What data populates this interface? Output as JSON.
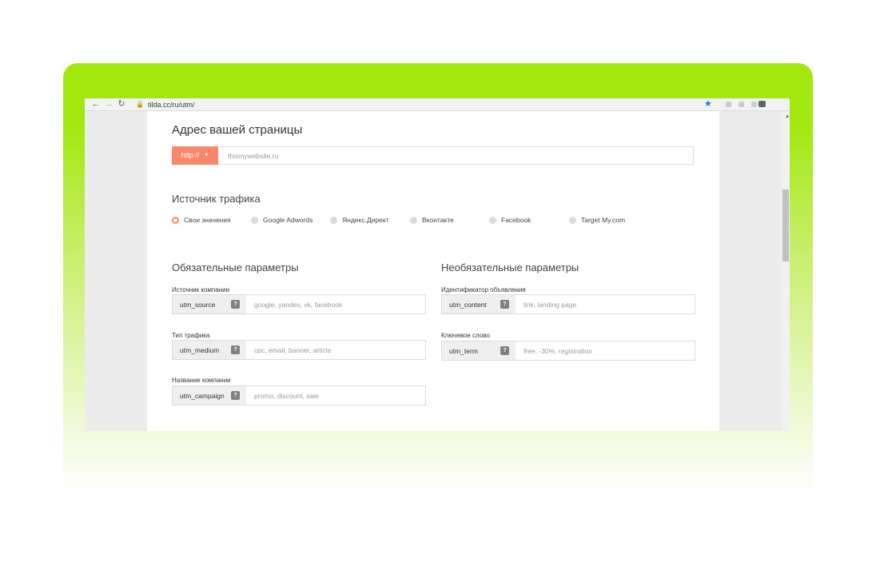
{
  "browser": {
    "url": "tilda.cc/ru/utm/",
    "icons": {
      "back": "arrow-left-icon",
      "forward": "arrow-right-icon",
      "reload": "reload-icon",
      "lock": "lock-icon",
      "bookmark": "star-icon"
    }
  },
  "address_section": {
    "title": "Адрес вашей страницы",
    "protocol": "http://",
    "placeholder": "thismywebsite.ru"
  },
  "traffic": {
    "title": "Источник трафика",
    "options": [
      {
        "label": "Свои значения",
        "selected": true
      },
      {
        "label": "Google Adwords",
        "selected": false
      },
      {
        "label": "Яндекс.Директ",
        "selected": false
      },
      {
        "label": "Вконтакте",
        "selected": false
      },
      {
        "label": "Facebook",
        "selected": false
      },
      {
        "label": "Target My.com",
        "selected": false
      }
    ]
  },
  "required": {
    "title": "Обязательные параметры",
    "fields": [
      {
        "label": "Источник компании",
        "tag": "utm_source",
        "placeholder": "google, yandex, vk, facebook"
      },
      {
        "label": "Тип трафика",
        "tag": "utm_medium",
        "placeholder": "cpc, email, banner, article"
      },
      {
        "label": "Название компании",
        "tag": "utm_campaign",
        "placeholder": "promo, discount, sale"
      }
    ]
  },
  "optional": {
    "title": "Необязательные параметры",
    "fields": [
      {
        "label": "Идентификатор объявления",
        "tag": "utm_content",
        "placeholder": "link, landing page"
      },
      {
        "label": "Ключевое слово",
        "tag": "utm_term",
        "placeholder": "free, -30%, registration"
      }
    ]
  },
  "help_glyph": "?",
  "colors": {
    "accent": "#fa876b",
    "frame": "#a2e80f",
    "star": "#1a73e8"
  }
}
